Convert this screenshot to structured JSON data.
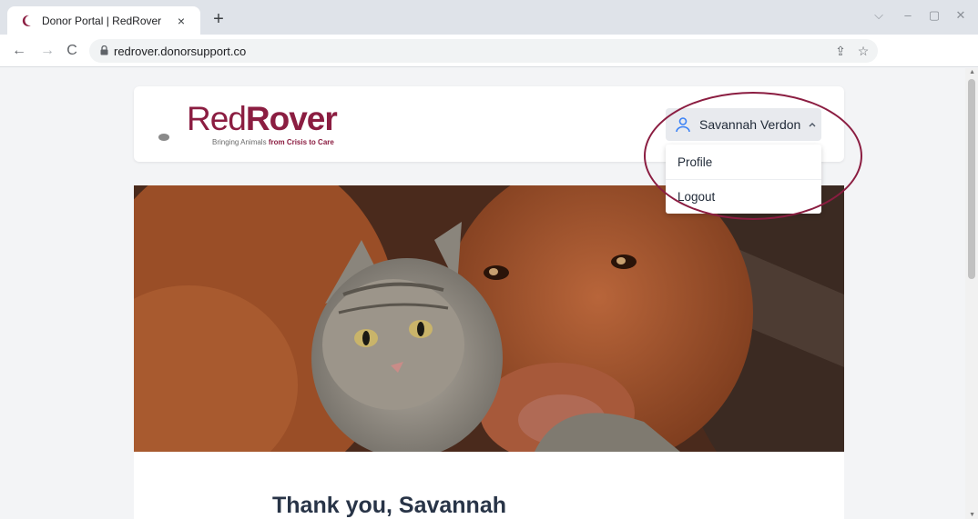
{
  "browser": {
    "tab": {
      "title": "Donor Portal | RedRover",
      "close": "×"
    },
    "new_tab": "+",
    "url": "redrover.donorsupport.co",
    "controls": {
      "minimize": "–",
      "chevron": "⌵",
      "maximize": "▢",
      "close": "✕"
    },
    "nav": {
      "back": "←",
      "forward": "→",
      "reload": "C"
    },
    "omni": {
      "share": "⇪",
      "star": "☆"
    }
  },
  "header": {
    "logo": {
      "word_red": "Red",
      "word_rover": "Rover",
      "tagline_prefix": "Bringing Animals ",
      "tagline_bold": "from Crisis to Care"
    },
    "user_menu": {
      "name": "Savannah Verdon",
      "items": [
        {
          "label": "Profile"
        },
        {
          "label": "Logout"
        }
      ]
    }
  },
  "main": {
    "greeting": "Thank you, Savannah"
  },
  "colors": {
    "brand": "#8b1d41",
    "highlight": "#8b1d41",
    "user_icon": "#3b82f6"
  }
}
